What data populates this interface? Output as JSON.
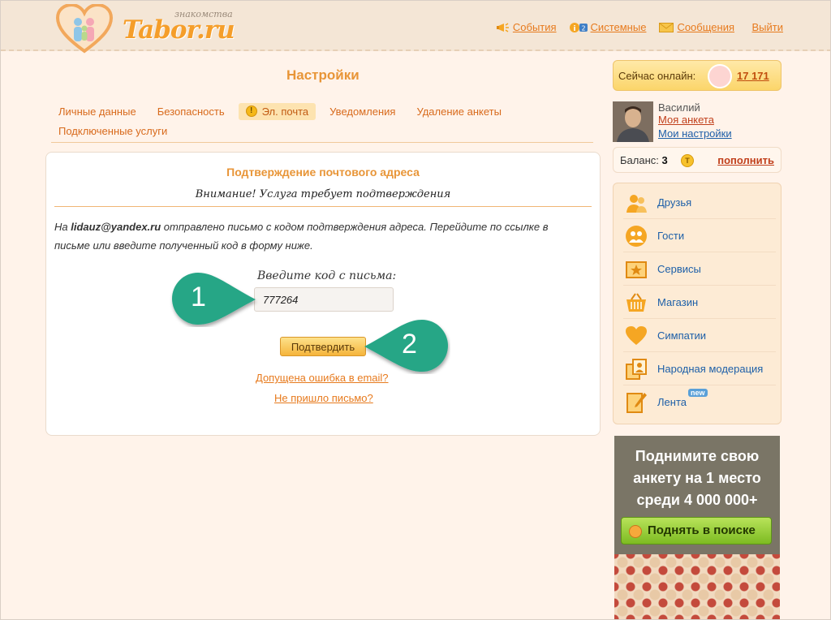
{
  "header": {
    "logo_text": "Tabor.ru",
    "logo_sub": "знакомства",
    "nav": {
      "events": "События",
      "system": "Системные",
      "system_badge": "2",
      "messages": "Сообщения",
      "exit": "Выйти"
    }
  },
  "main": {
    "title": "Настройки",
    "tabs": [
      "Личные данные",
      "Безопасность",
      "Эл. почта",
      "Уведомления",
      "Удаление анкеты",
      "Подключенные услуги"
    ],
    "active_tab": "Эл. почта",
    "panel": {
      "title": "Подтверждение почтового адреса",
      "warning": "Внимание! Услуга требует подтверждения",
      "text_prefix": "На ",
      "email": "lidauz@yandex.ru",
      "text_suffix": " отправлено письмо с кодом подтверждения адреса. Перейдите по ссылке в письме или введите полученный код в форму ниже.",
      "code_label": "Введите код с письма:",
      "code_value": "777264",
      "confirm_label": "Подтвердить",
      "link_error": "Допущена ошибка в email?",
      "link_no_mail": "Не пришло письмо?"
    },
    "callouts": [
      "1",
      "2"
    ]
  },
  "sidebar": {
    "online_label": "Сейчас онлайн:",
    "online_count": "17 171",
    "user": {
      "name": "Василий",
      "profile_link": "Моя анкета",
      "settings_link": "Мои настройки"
    },
    "balance_label": "Баланс:",
    "balance_value": "3",
    "topup_label": "пополнить",
    "menu": [
      {
        "label": "Друзья",
        "icon": "friends-icon"
      },
      {
        "label": "Гости",
        "icon": "guests-icon"
      },
      {
        "label": "Сервисы",
        "icon": "services-icon"
      },
      {
        "label": "Магазин",
        "icon": "shop-icon"
      },
      {
        "label": "Симпатии",
        "icon": "heart-icon"
      },
      {
        "label": "Народная модерация",
        "icon": "moderation-icon"
      },
      {
        "label": "Лента",
        "icon": "feed-icon",
        "badge": "new"
      }
    ],
    "promo": {
      "line1": "Поднимите свою",
      "line2": "анкету на 1 место",
      "line3": "среди 4 000 000+",
      "button": "Поднять в поиске"
    }
  },
  "colors": {
    "accent": "#e89537",
    "link": "#e77a1d",
    "callout": "#27a686"
  }
}
